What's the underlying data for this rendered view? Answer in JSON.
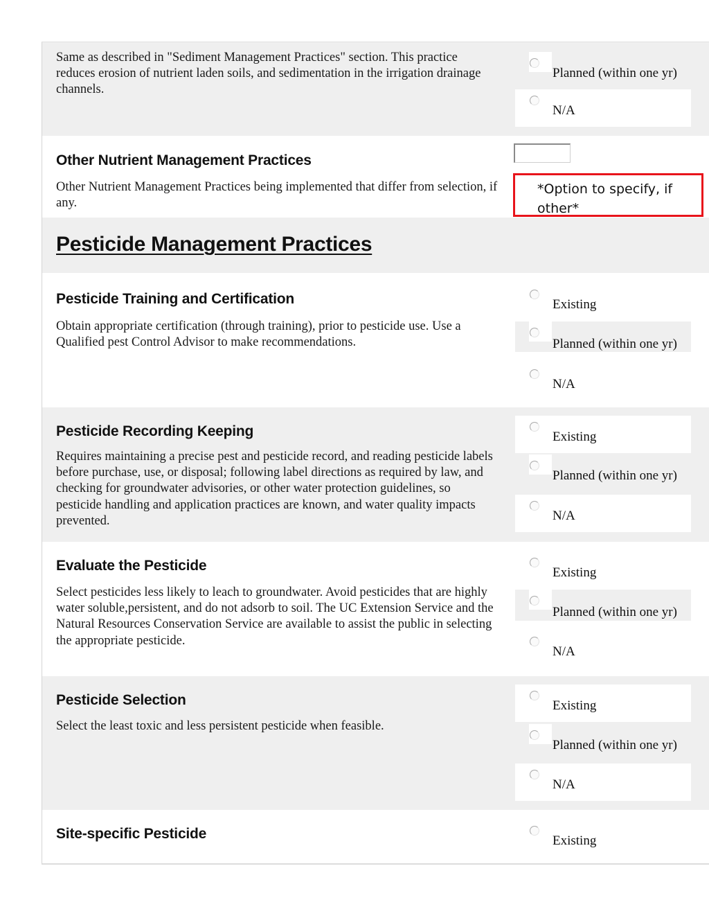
{
  "rows": {
    "nutrient_carryover": {
      "description": "Same as described in \"Sediment Management Practices\" section. This practice reduces erosion of nutrient laden soils, and sedimentation in the irrigation drainage channels.",
      "options": [
        "Planned (within one yr)",
        "N/A"
      ]
    },
    "other_nutrient": {
      "title": "Other Nutrient Management Practices",
      "description": "Other Nutrient Management Practices being implemented that differ from selection, if any.",
      "input_value": "",
      "annotation": "*Option to specify, if other*"
    },
    "section": {
      "heading": "Pesticide Management Practices"
    },
    "training": {
      "title": "Pesticide Training and Certification",
      "description": "Obtain appropriate certification (through training), prior to pesticide use. Use a Qualified pest Control Advisor to make recommendations.",
      "options": [
        "Existing",
        "Planned (within one yr)",
        "N/A"
      ]
    },
    "recording": {
      "title": "Pesticide Recording Keeping",
      "description": "Requires maintaining a precise pest and pesticide record, and reading pesticide labels before purchase, use, or disposal; following label directions as required by law, and checking for groundwater advisories, or other water protection guidelines, so pesticide handling and application practices are known, and water quality impacts prevented.",
      "options": [
        "Existing",
        "Planned (within one yr)",
        "N/A"
      ]
    },
    "evaluate": {
      "title": "Evaluate the Pesticide",
      "description": "Select pesticides less likely to leach to groundwater. Avoid pesticides that are highly water soluble,persistent, and do not adsorb to soil. The UC Extension Service and the Natural Resources Conservation Service are available to assist the public in selecting the appropriate pesticide.",
      "options": [
        "Existing",
        "Planned (within one yr)",
        "N/A"
      ]
    },
    "selection": {
      "title": "Pesticide Selection",
      "description": "Select the least toxic and less persistent pesticide when  feasible.",
      "options": [
        "Existing",
        "Planned (within one yr)",
        "N/A"
      ]
    },
    "site_specific": {
      "title": "Site-specific Pesticide",
      "options": [
        "Existing"
      ]
    }
  },
  "colors": {
    "row_gray": "#efefef",
    "annotation_border": "#e8141b"
  }
}
